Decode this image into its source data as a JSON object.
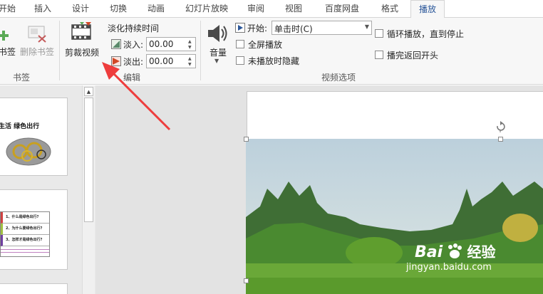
{
  "tabs": [
    {
      "label": "开始",
      "active": false
    },
    {
      "label": "插入",
      "active": false
    },
    {
      "label": "设计",
      "active": false
    },
    {
      "label": "切换",
      "active": false
    },
    {
      "label": "动画",
      "active": false
    },
    {
      "label": "幻灯片放映",
      "active": false
    },
    {
      "label": "审阅",
      "active": false
    },
    {
      "label": "视图",
      "active": false
    },
    {
      "label": "百度网盘",
      "active": false
    },
    {
      "label": "格式",
      "active": false
    },
    {
      "label": "播放",
      "active": true
    }
  ],
  "ribbon": {
    "bookmarks": {
      "add_label": "书签",
      "remove_label": "删除书签",
      "group_label": "书签"
    },
    "editing": {
      "trim_label": "剪裁视频",
      "fade_title": "淡化持续时间",
      "fade_in_label": "淡入:",
      "fade_in_value": "00.00",
      "fade_out_label": "淡出:",
      "fade_out_value": "00.00",
      "group_label": "编辑"
    },
    "video_options": {
      "volume_label": "音量",
      "start_label": "开始:",
      "start_value": "单击时(C)",
      "fullscreen_label": "全屏播放",
      "hide_label": "未播放时隐藏",
      "loop_label": "循环播放，直到停止",
      "rewind_label": "播完返回开头",
      "group_label": "视频选项"
    }
  },
  "slides": {
    "slide1_title": "生活 绿色出行",
    "slide2_items": [
      "1、什么是绿色出行?",
      "2、为什么要绿色出行?",
      "3、怎样才是绿色出行?"
    ]
  },
  "watermark": {
    "brand": "Bai",
    "brand_suffix": "经验",
    "url": "jingyan.baidu.com"
  },
  "colors": {
    "accent": "#2b579a",
    "arrow": "#ee3d3d",
    "grass": "#5f9e2e",
    "sky": "#cfe0ea"
  }
}
